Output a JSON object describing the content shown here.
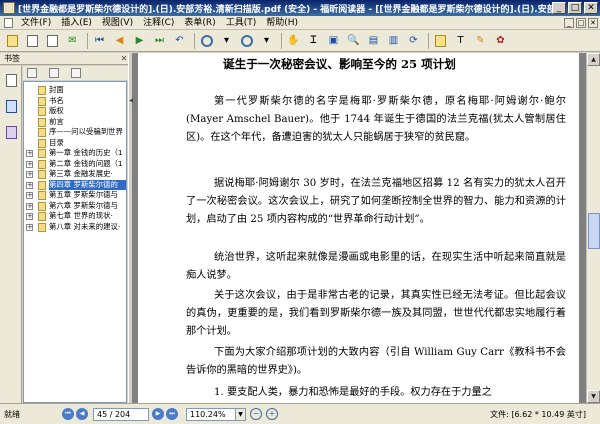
{
  "window": {
    "title": "[世界金融都是罗斯柴尔德设计的].(日).安部芳裕.清新扫描版.pdf (安全) - 福昕阅读器 - [[世界金融都是罗斯柴尔德设计的].(日).安部芳裕.清新扫描版...",
    "min_glyph": "_",
    "max_glyph": "□",
    "close_glyph": "✕"
  },
  "menubar": {
    "items": [
      "文件(F)",
      "插入(E)",
      "视图(V)",
      "注释(C)",
      "表单(R)",
      "工具(T)",
      "帮助(H)"
    ],
    "right_buttons": [
      "_",
      "□",
      "✕"
    ]
  },
  "toolbar": {
    "icons": [
      "open-icon",
      "print-icon",
      "save-icon",
      "email-icon",
      "first-page-icon",
      "prev-page-icon",
      "next-page-icon",
      "last-page-icon",
      "undo-icon",
      "redo-icon",
      "zoom-out-icon",
      "zoom-dropdown-icon",
      "zoom-in-icon",
      "hand-tool-icon",
      "select-text-icon",
      "snapshot-icon",
      "find-icon",
      "fit-page-icon",
      "fit-width-icon",
      "rotate-icon",
      "note-icon",
      "typewriter-icon",
      "highlight-icon",
      "stamp-icon"
    ]
  },
  "sidebar": {
    "title": "书签",
    "close_glyph": "✕",
    "bookmarks": [
      {
        "label": "封面",
        "expandable": false
      },
      {
        "label": "书名",
        "expandable": false
      },
      {
        "label": "版权",
        "expandable": false
      },
      {
        "label": "前言",
        "expandable": false
      },
      {
        "label": "序——问以受骗到世界",
        "expandable": false
      },
      {
        "label": "目录",
        "expandable": false
      },
      {
        "label": "第一章 金钱的历史（1",
        "expandable": true
      },
      {
        "label": "第二章 金钱的问题（1",
        "expandable": true
      },
      {
        "label": "第三章 金融发展史·",
        "expandable": true
      },
      {
        "label": "第四章 罗斯柴尔德的",
        "expandable": true,
        "selected": true
      },
      {
        "label": "第五章 罗斯柴尔德与",
        "expandable": true
      },
      {
        "label": "第六章 罗斯柴尔德与",
        "expandable": true
      },
      {
        "label": "第七章 世界的现状·",
        "expandable": true
      },
      {
        "label": "第八章 对未来的建议·",
        "expandable": true
      }
    ]
  },
  "document": {
    "chapter_title": "诞生于一次秘密会议、影响至今的 25 项计划",
    "paragraphs": [
      "第一代罗斯柴尔德的名字是梅耶·罗斯柴尔德，原名梅耶·阿姆谢尔·鲍尔(Mayer Amschel Bauer)。他于 1744 年诞生于德国的法兰克福(犹太人管制居住区)。在这个年代，备遭迫害的犹太人只能蜗居于狭窄的贫民窟。",
      "据说梅耶·阿姆谢尔 30 岁时，在法兰克福地区招募 12 名有实力的犹太人召开了一次秘密会议。这次会议上，研究了如何垄断控制全世界的智力、能力和资源的计划，启动了由 25 项内容构成的“世界革命行动计划”。",
      "统治世界，这听起来就像是漫画或电影里的话，在现实生活中听起来简直就是痴人说梦。",
      "关于这次会议，由于是非常古老的记录，其真实性已经无法考证。但比起会议的真伪，更重要的是，我们看到罗斯柴尔德一族及其同盟，世世代代都忠实地履行着那个计划。",
      "下面为大家介绍那项计划的大致内容（引自 William Guy Carr《教科书不会告诉你的黑暗的世界史》)。",
      "1. 要支配人类，暴力和恐怖是最好的手段。权力存在于力量之"
    ]
  },
  "statusbar": {
    "ready": "就绪",
    "page_value": "45 / 204",
    "zoom_value": "110.24%",
    "file_info": "文件: [6.62 * 10.49 英寸]"
  }
}
